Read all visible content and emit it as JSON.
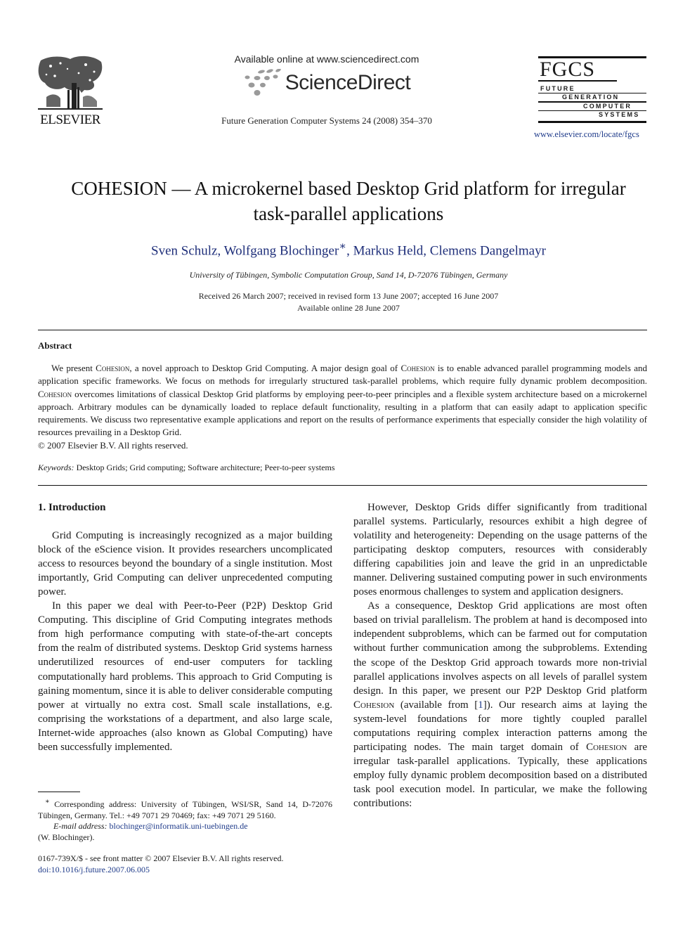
{
  "header": {
    "publisher": "ELSEVIER",
    "available_online": "Available online at www.sciencedirect.com",
    "sciencedirect": "ScienceDirect",
    "journal_ref": "Future Generation Computer Systems 24 (2008) 354–370",
    "journal_logo": {
      "abbr": "FGCS",
      "lines": [
        "FUTURE",
        "GENERATION",
        "COMPUTER",
        "SYSTEMS"
      ]
    },
    "journal_url": "www.elsevier.com/locate/fgcs"
  },
  "article": {
    "title_line1": "COHESION — A microkernel based Desktop Grid platform for irregular",
    "title_line2": "task-parallel applications",
    "authors": [
      {
        "name": "Sven Schulz",
        "mark": ""
      },
      {
        "name": "Wolfgang Blochinger",
        "mark": "∗"
      },
      {
        "name": "Markus Held",
        "mark": ""
      },
      {
        "name": "Clemens Dangelmayr",
        "mark": ""
      }
    ],
    "affiliation": "University of Tübingen, Symbolic Computation Group, Sand 14, D-72076 Tübingen, Germany",
    "dates_line1": "Received 26 March 2007; received in revised form 13 June 2007; accepted 16 June 2007",
    "dates_line2": "Available online 28 June 2007"
  },
  "abstract": {
    "heading": "Abstract",
    "system_name": "Cohesion",
    "segments": [
      "We present ",
      "{SYS}",
      ", a novel approach to Desktop Grid Computing. A major design goal of ",
      "{SYS}",
      " is to enable advanced parallel programming models and application specific frameworks. We focus on methods for irregularly structured task-parallel problems, which require fully dynamic problem decomposition. ",
      "{SYS}",
      " overcomes limitations of classical Desktop Grid platforms by employing peer-to-peer principles and a flexible system architecture based on a microkernel approach. Arbitrary modules can be dynamically loaded to replace default functionality, resulting in a platform that can easily adapt to application specific requirements. We discuss two representative example applications and report on the results of performance experiments that especially consider the high volatility of resources prevailing in a Desktop Grid."
    ],
    "copyright": "© 2007 Elsevier B.V. All rights reserved.",
    "keywords_label": "Keywords:",
    "keywords": "Desktop Grids; Grid computing; Software architecture; Peer-to-peer systems"
  },
  "body": {
    "section_heading": "1.  Introduction",
    "left_paragraphs": [
      "Grid Computing is increasingly recognized as a major building block of the eScience vision. It provides researchers uncomplicated access to resources beyond the boundary of a single institution. Most importantly, Grid Computing can deliver unprecedented computing power.",
      "In this paper we deal with Peer-to-Peer (P2P) Desktop Grid Computing. This discipline of Grid Computing integrates methods from high performance computing with state-of-the-art concepts from the realm of distributed systems. Desktop Grid systems harness underutilized resources of end-user computers for tackling computationally hard problems. This approach to Grid Computing is gaining momentum, since it is able to deliver considerable computing power at virtually no extra cost. Small scale installations, e.g. comprising the workstations of a department, and also large scale, Internet-wide approaches (also known as Global Computing) have been successfully implemented."
    ],
    "right_p1": "However, Desktop Grids differ significantly from traditional parallel systems. Particularly, resources exhibit a high degree of volatility and heterogeneity: Depending on the usage patterns of the participating desktop computers, resources with considerably differing capabilities join and leave the grid in an unpredictable manner. Delivering sustained computing power in such environments poses enormous challenges to system and application designers.",
    "right_p2_a": "As a consequence, Desktop Grid applications are most often based on trivial parallelism. The problem at hand is decomposed into independent subproblems, which can be farmed out for computation without further communication among the subproblems. Extending the scope of the Desktop Grid approach towards more non-trivial parallel applications involves aspects on all levels of parallel system design. In this paper, we present our P2P Desktop Grid platform ",
    "right_p2_sys1": "Cohesion",
    "right_p2_b": " (available from [",
    "right_p2_ref": "1",
    "right_p2_c": "]). Our research aims at laying the system-level foundations for more tightly coupled parallel computations requiring complex interaction patterns among the participating nodes. The main target domain of ",
    "right_p2_sys2": "Cohesion",
    "right_p2_d": " are irregular task-parallel applications. Typically, these applications employ fully dynamic problem decomposition based on a distributed task pool execution model. In particular, we make the following contributions:"
  },
  "footnote": {
    "mark": "∗",
    "text": " Corresponding address: University of Tübingen, WSI/SR, Sand 14, D-72076 Tübingen, Germany. Tel.: +49 7071 29 70469; fax: +49 7071 29 5160.",
    "email_label": "E-mail address:",
    "email": "blochinger@informatik.uni-tuebingen.de",
    "email_owner": "(W. Blochinger)."
  },
  "front_matter": {
    "issn_line": "0167-739X/$ - see front matter © 2007 Elsevier B.V. All rights reserved.",
    "doi": "doi:10.1016/j.future.2007.06.005"
  },
  "colors": {
    "link": "#1f3b8a",
    "authors": "#1f2f7a",
    "text": "#1a1a1a"
  }
}
